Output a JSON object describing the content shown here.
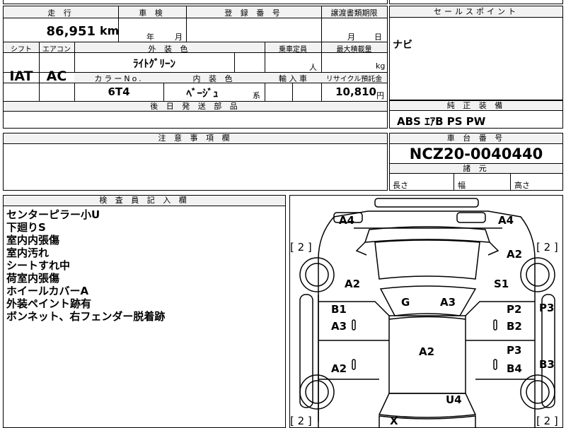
{
  "headers": {
    "mileage": "走 行",
    "inspection": "車 検",
    "registration": "登 録 番 号",
    "transfer_docs": "譲渡書類期限",
    "sales_point": "セールスポイント",
    "shift": "シフト",
    "aircon": "エアコン",
    "exterior_color": "外 装 色",
    "capacity": "乗車定員",
    "max_load": "最大積載量",
    "color_no": "カラーNo.",
    "interior_color": "内 装 色",
    "import": "輸 入 車",
    "recycle": "リサイクル預託金",
    "later_parts": "後 日 発 送 部 品",
    "equipment": "純 正 装 備",
    "notes": "注 意 事 項 欄",
    "chassis_no": "車 台 番 号",
    "dimensions": "諸 元",
    "inspector": "検 査 員 記 入 欄"
  },
  "units": {
    "km": "km",
    "year": "年",
    "month": "月",
    "transfer_month": "月",
    "transfer_day": "日",
    "person": "人",
    "kg": "kg",
    "kei": "系",
    "yen": "円"
  },
  "values": {
    "mileage": "86,951",
    "shift": "IAT",
    "aircon": "AC",
    "exterior_color": "ﾗｲﾄｸﾞﾘｰﾝ",
    "color_no": "6T4",
    "interior_color": "ﾍﾞｰｼﾞｭ",
    "recycle": "10,810",
    "sales_point": "ナビ",
    "equipment": "ABS ｴｱB PS PW",
    "chassis_no": "NCZ20-0040440"
  },
  "dimensions": {
    "length": "長さ",
    "width": "幅",
    "height": "高さ"
  },
  "inspector_remarks": [
    "センターピラー小U",
    "下廻りS",
    "室内内張傷",
    "室内汚れ",
    "シートすれ中",
    "荷室内張傷",
    "ホイールカバーA",
    "外装ペイント跡有",
    "ボンネット、右フェンダー脱着跡"
  ],
  "diagram_marks": {
    "front_left": "A4",
    "front_right": "A4",
    "tire_fl": "[ 2 ]",
    "tire_fr": "[ 2 ]",
    "fender_fr": "A2",
    "fender_fl": "A2",
    "fender_fr_low": "S1",
    "windshield": "G",
    "hood": "A3",
    "door_fl_upper": "B1",
    "door_fl_lower": "A3",
    "door_fr_upper": "P2",
    "door_fr_lower": "B2",
    "pillar_right": "P3",
    "roof": "A2",
    "door_rl_lower": "A2",
    "door_rr_upper": "P3",
    "door_rr_lower": "B4",
    "quarter_right": "B3",
    "rear_upper": "U4",
    "rear_bottom": "X",
    "tire_rl": "[ 2 ]",
    "tire_rr": "[ 2 ]"
  }
}
